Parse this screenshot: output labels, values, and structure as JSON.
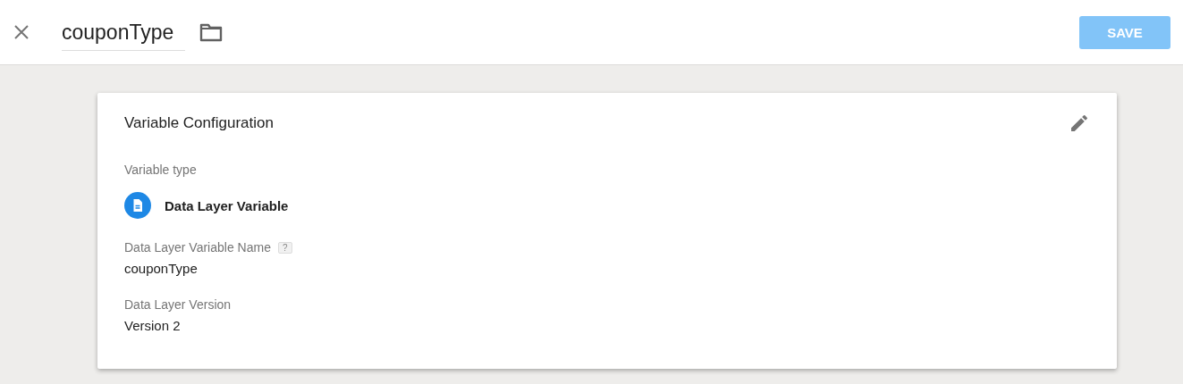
{
  "header": {
    "name_value": "couponType",
    "save_button": {
      "label": "SAVE",
      "disabled": true
    }
  },
  "card": {
    "title": "Variable Configuration",
    "variable_type": {
      "label": "Variable type",
      "value": "Data Layer Variable"
    },
    "fields": [
      {
        "label": "Data Layer Variable Name",
        "help": "?",
        "value": "couponType"
      },
      {
        "label": "Data Layer Version",
        "value": "Version 2"
      }
    ]
  }
}
